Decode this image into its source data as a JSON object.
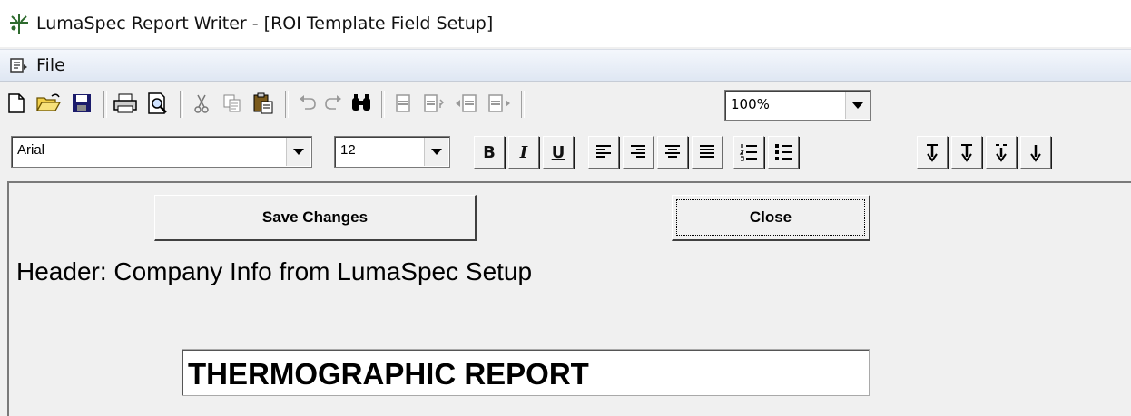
{
  "window": {
    "title": "LumaSpec Report Writer - [ROI Template Field Setup]"
  },
  "menu": {
    "file": "File"
  },
  "toolbar": {
    "zoom": {
      "value": "100%"
    },
    "font": {
      "value": "Arial"
    },
    "size": {
      "value": "12"
    },
    "bold_label": "B",
    "italic_label": "I",
    "underline_label": "U"
  },
  "form": {
    "save_label": "Save Changes",
    "close_label": "Close",
    "header_text": "Header:  Company Info from LumaSpec Setup",
    "report_title_value": "THERMOGRAPHIC REPORT"
  },
  "icons": {
    "app": "lumaspec-app-icon",
    "menu_doc": "document-menu-icon"
  },
  "colors": {
    "menubar": "#dfe7f3",
    "background": "#f0f0f0"
  }
}
